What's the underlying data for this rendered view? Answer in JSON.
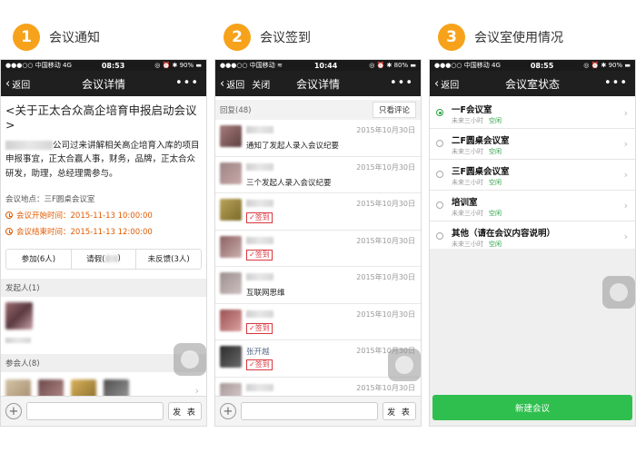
{
  "sections": [
    {
      "number": "1",
      "title": "会议通知"
    },
    {
      "number": "2",
      "title": "会议签到"
    },
    {
      "number": "3",
      "title": "会议室使用情况"
    }
  ],
  "phone1": {
    "status": {
      "carrier": "●●●○○ 中国移动  4G",
      "time": "08:53",
      "right": "◎ ⏰ ✱ 90% ▬"
    },
    "nav": {
      "back": "返回",
      "title": "会议详情",
      "more": "•••"
    },
    "headline": "<关于正太合众高企培育申报启动会议>",
    "body_tail1": "公司过来讲解相关高企培育入库的项目",
    "body_line2": "申报事宜，正太合赢人事，财务，品牌，正太合众",
    "body_line3": "研发，助理，总经理需参与。",
    "location": "会议地点：三F圆桌会议室",
    "start_time": "会议开始时间：2015-11-13 10:00:00",
    "end_time": "会议结束时间：2015-11-13 12:00:00",
    "tabs": {
      "join": "参加(6人)",
      "leave": "请假(",
      "leave_tail": ")",
      "no_reply": "未反馈(3人)"
    },
    "initiator_label": "发起人(1)",
    "participants_label": "参会人(8)",
    "more_arrow": "›",
    "input": {
      "plus": "+",
      "send": "发 表"
    }
  },
  "phone2": {
    "status": {
      "carrier": "●●●○○ 中国移动  ≋",
      "time": "10:44",
      "right": "◎ ⏰ ✱ 80% ▬"
    },
    "nav": {
      "back": "返回",
      "close": "关闭",
      "title": "会议详情",
      "more": "•••"
    },
    "reply_count": "回复(48)",
    "filter": "只看评论",
    "signed_label": "签到",
    "comments": [
      {
        "name": "",
        "date": "2015年10月30日",
        "text": "通知了发起人录入会议纪要",
        "signed": false
      },
      {
        "name": "",
        "date": "2015年10月30日",
        "text": "三个发起人录入会议纪要",
        "signed": false
      },
      {
        "name": "",
        "date": "2015年10月30日",
        "text": "",
        "signed": true
      },
      {
        "name": "",
        "date": "2015年10月30日",
        "text": "",
        "signed": true
      },
      {
        "name": "",
        "date": "2015年10月30日",
        "text": "互联网思维",
        "signed": false
      },
      {
        "name": "",
        "date": "2015年10月30日",
        "text": "",
        "signed": true
      },
      {
        "name": "张开越",
        "date": "2015年10月30日",
        "text": "",
        "signed": true
      },
      {
        "name": "",
        "date": "2015年10月30日",
        "text": "",
        "signed": false
      }
    ],
    "input": {
      "plus": "+",
      "send": "发 表"
    }
  },
  "phone3": {
    "status": {
      "carrier": "●●●○○ 中国移动  4G",
      "time": "08:55",
      "right": "◎ ⏰ ✱ 90% ▬"
    },
    "nav": {
      "back": "返回",
      "title": "会议室状态",
      "more": "•••"
    },
    "rooms": [
      {
        "name": "一F会议室",
        "sub": "未来三小时",
        "status": "空闲",
        "selected": true
      },
      {
        "name": "二F圆桌会议室",
        "sub": "未来三小时",
        "status": "空闲",
        "selected": false
      },
      {
        "name": "三F圆桌会议室",
        "sub": "未来三小时",
        "status": "空闲",
        "selected": false
      },
      {
        "name": "培训室",
        "sub": "未来三小时",
        "status": "空闲",
        "selected": false
      },
      {
        "name": "其他（请在会议内容说明）",
        "sub": "未来三小时",
        "status": "空闲",
        "selected": false
      }
    ],
    "arrow": "›",
    "create_button": "新建会议"
  },
  "colors": {
    "accent_orange": "#f7a21b",
    "time_orange": "#e05a00",
    "green": "#2fbf4e",
    "signed_red": "#d9363e"
  }
}
